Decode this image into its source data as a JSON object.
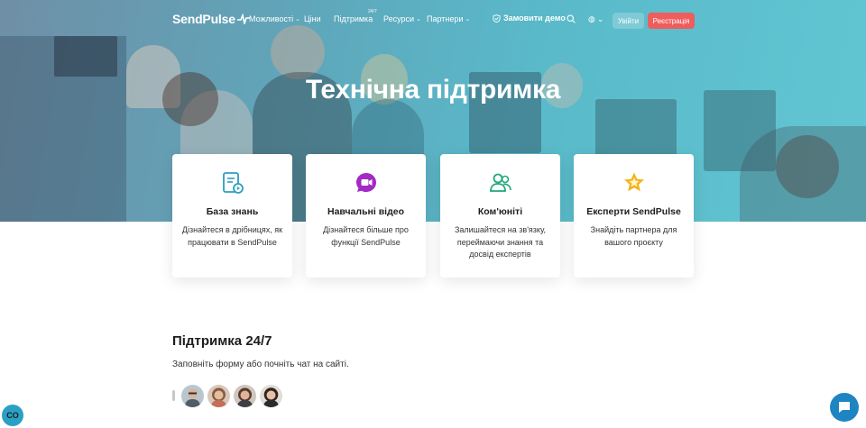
{
  "nav": {
    "logo": "SendPulse",
    "items": [
      {
        "label": "Можливості",
        "dropdown": true
      },
      {
        "label": "Ціни",
        "dropdown": false
      },
      {
        "label": "Підтримка",
        "dropdown": false
      },
      {
        "label": "Ресурси",
        "dropdown": true
      },
      {
        "label": "Партнери",
        "dropdown": true
      }
    ],
    "support_badge": "24/7",
    "demo": "Замовити демо",
    "login": "Увійти",
    "register": "Реєстрація"
  },
  "hero": {
    "title": "Технічна підтримка"
  },
  "cards": [
    {
      "title": "База знань",
      "description": "Дізнайтеся в дрібницях, як працювати в SendPulse",
      "icon": "knowledge-base-icon",
      "color": "#2a9fc2"
    },
    {
      "title": "Навчальні відео",
      "description": "Дізнайтеся більше про функції SendPulse",
      "icon": "video-icon",
      "color": "#a22bc4"
    },
    {
      "title": "Ком'юніті",
      "description": "Залишайтеся на зв'язку, переймаючи знання та досвід експертів",
      "icon": "community-icon",
      "color": "#20a87a"
    },
    {
      "title": "Експерти SendPulse",
      "description": "Знайдіть партнера для вашого проєкту",
      "icon": "expert-star-icon",
      "color": "#f2b31c"
    }
  ],
  "support": {
    "title": "Підтримка 24/7",
    "text": "Заповніть форму або почніть чат на сайті."
  },
  "corner_badge": "CO",
  "colors": {
    "accent": "#2aa1c4",
    "register": "#ef5d5d",
    "chat": "#1f85c2"
  }
}
